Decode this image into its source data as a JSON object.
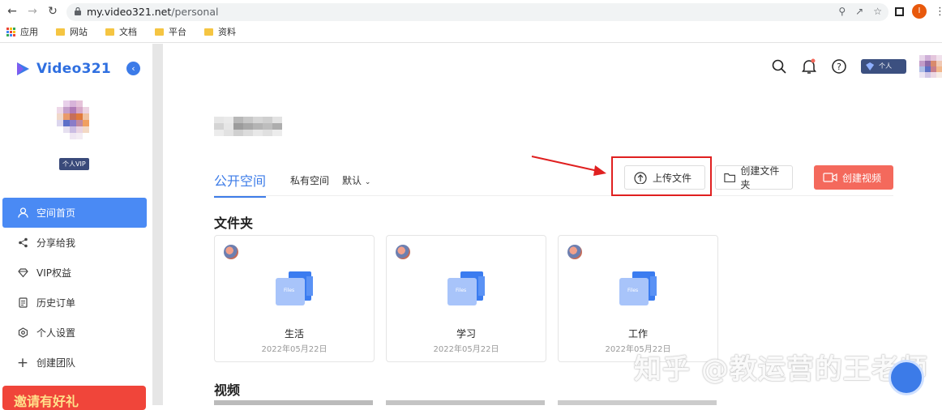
{
  "browser": {
    "url_host": "my.video321.net",
    "url_path": "/personal",
    "profile_initial": "I",
    "bookmarks": [
      "应用",
      "网站",
      "文档",
      "平台",
      "资料"
    ]
  },
  "sidebar": {
    "logo_text": "Video321",
    "vip_badge": "个人VIP",
    "menu": [
      {
        "label": "空间首页",
        "icon": "user-icon",
        "active": true
      },
      {
        "label": "分享给我",
        "icon": "share-icon",
        "active": false
      },
      {
        "label": "VIP权益",
        "icon": "diamond-icon",
        "active": false
      },
      {
        "label": "历史订单",
        "icon": "order-icon",
        "active": false
      },
      {
        "label": "个人设置",
        "icon": "settings-icon",
        "active": false
      },
      {
        "label": "创建团队",
        "icon": "plus-icon",
        "active": false
      }
    ],
    "promo_text": "邀请有好礼"
  },
  "header": {
    "vip_label": "个人VIP"
  },
  "tabs": {
    "public": "公开空间",
    "private": "私有空间",
    "sort": "默认"
  },
  "actions": {
    "upload": "上传文件",
    "create_folder": "创建文件夹",
    "create_video": "创建视频"
  },
  "sections": {
    "folders_title": "文件夹",
    "videos_title": "视频"
  },
  "folders": [
    {
      "name": "生活",
      "date": "2022年05月22日"
    },
    {
      "name": "学习",
      "date": "2022年05月22日"
    },
    {
      "name": "工作",
      "date": "2022年05月22日"
    }
  ],
  "watermark": "知乎 @教运营的王老师",
  "colors": {
    "primary": "#3d7ce8",
    "active_menu": "#4a8af4",
    "video_button": "#f4695c",
    "highlight_box": "#e02020"
  }
}
